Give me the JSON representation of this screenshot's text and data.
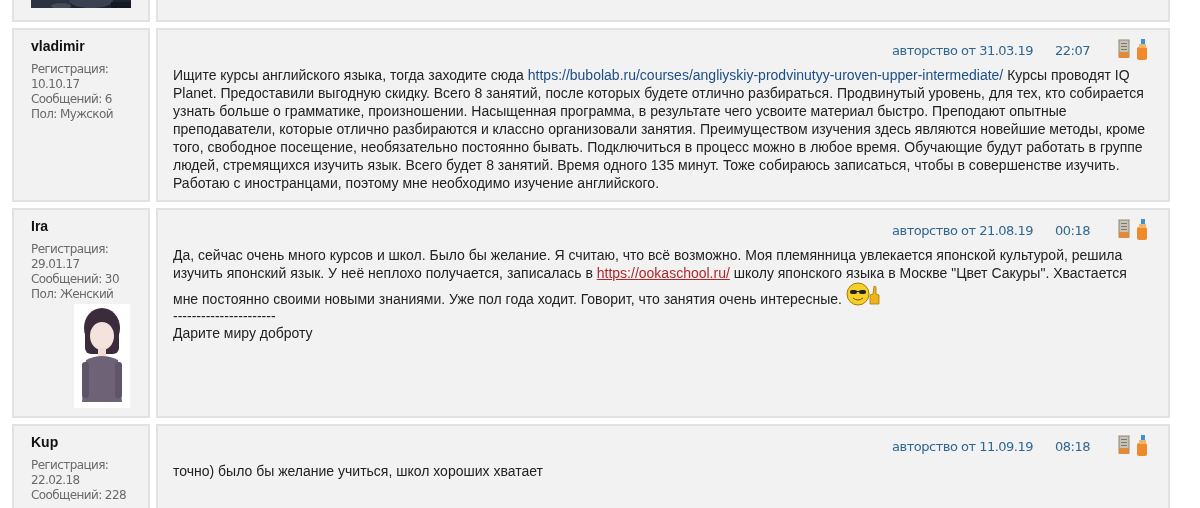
{
  "posts": [
    {
      "avatar": {
        "kind": "picture"
      }
    },
    {
      "author": "vladimir",
      "info": [
        "Регистрация:",
        "10.10.17",
        "Сообщений: 6",
        "Пол: Мужской"
      ],
      "date": "авторство от 31.03.19",
      "time": "22:07",
      "body": [
        {
          "kind": "text",
          "text": "Ищите курсы английского языка, тогда заходите сюда "
        },
        {
          "kind": "link",
          "text": "https://bubolab.ru/courses/angliyskiy-prodvinutyy-uroven-upper-intermediate/",
          "visited": false
        },
        {
          "kind": "text",
          "text": " Курсы проводят IQ Planet. Предоставили выгодную скидку. Всего 8 занятий, после которых будете отлично разбираться. Продвинутый уровень, для тех, кто собирается узнать больше о грамматике, произношении. Насыщенная программа, в результате чего усвоите материал быстро. Преподают опытные преподаватели, которые отлично разбираются и классно организовали занятия. Преимуществом изучения здесь являются новейшие методы, кроме того, свободное посещение, необязательно постоянно бывать. Подключиться в процесс можно в любое время. Обучающие будут работать в группе людей, стремящихся изучить язык. Всего будет 8 занятий. Время одного 135 минут. Тоже собираюсь записаться, чтобы в совершенстве изучить. Работаю с иностранцами, поэтому мне необходимо изучение английского."
        }
      ]
    },
    {
      "author": "Ira",
      "info": [
        "Регистрация:",
        "29.01.17",
        "Сообщений: 30",
        "Пол: Женский"
      ],
      "avatar": {
        "kind": "picture"
      },
      "date": "авторство от 21.08.19",
      "time": "00:18",
      "body": [
        {
          "kind": "text",
          "text": "Да, сейчас очень много курсов и школ. Было бы желание. Я считаю, что всё возможно. Моя племянница увлекается японской культурой, решила изучить японский язык. У неё неплохо получается, записалась в "
        },
        {
          "kind": "link",
          "text": "https://ookaschool.ru/",
          "visited": true
        },
        {
          "kind": "text",
          "text": " школу японского языка в Москве \"Цвет Сакуры\". Хвастается мне постоянно своими новыми знаниями. Уже пол года ходит. Говорит, что занятия очень интересные. "
        },
        {
          "kind": "emoji"
        }
      ],
      "signature_divider": "----------------------",
      "signature": "Дарите миру доброту"
    },
    {
      "author": "Kup",
      "info": [
        "Регистрация:",
        "22.02.18",
        "Сообщений: 228"
      ],
      "date": "авторство от 11.09.19",
      "time": "08:18",
      "body": [
        {
          "kind": "text",
          "text": "точно) было бы желание учиться, школ хороших хватает"
        }
      ]
    }
  ]
}
